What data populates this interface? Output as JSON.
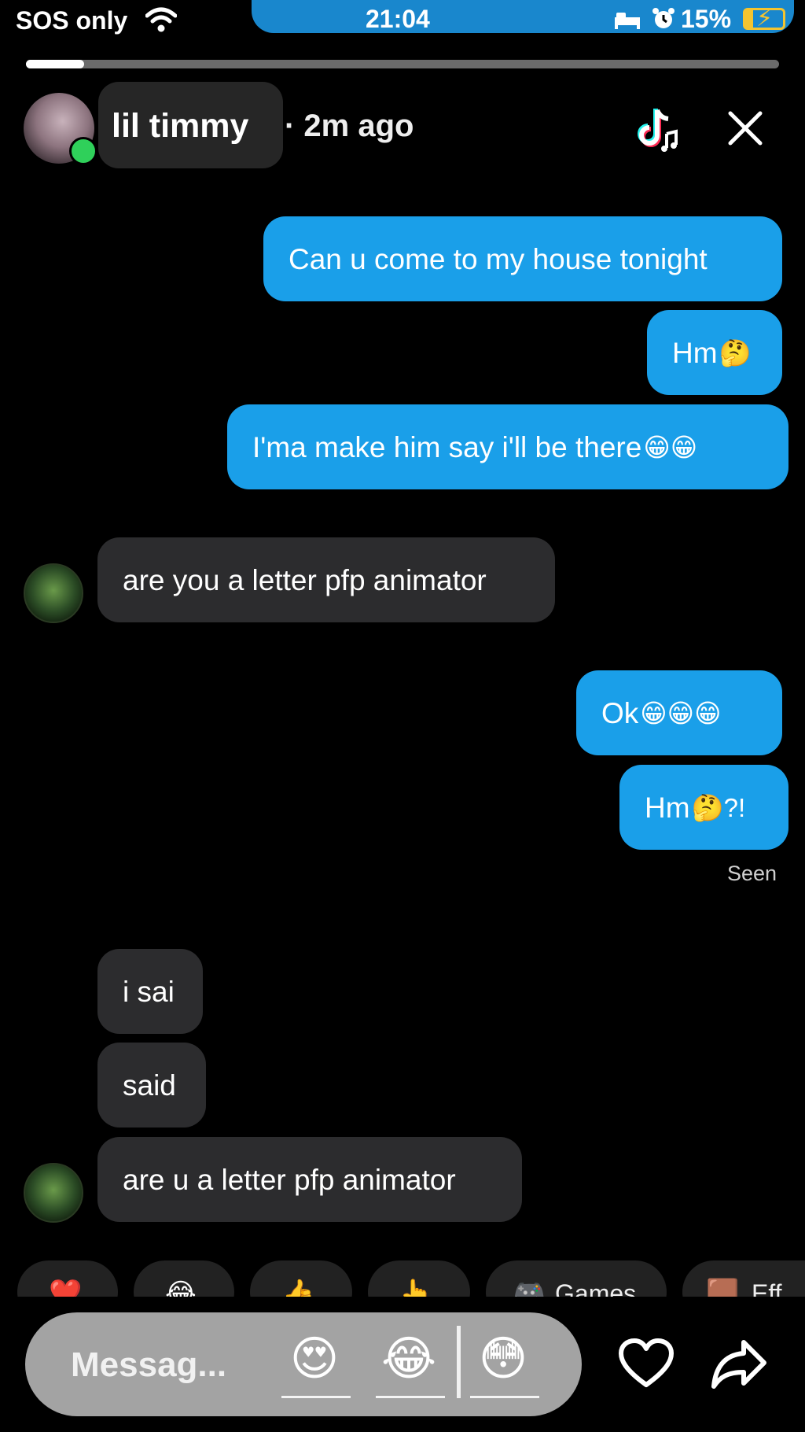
{
  "status_bar": {
    "carrier": "SOS only",
    "time": "21:04",
    "battery_percent": "15%",
    "icons": [
      "wifi-icon",
      "bed-icon",
      "alarm-icon",
      "battery-charging-icon"
    ]
  },
  "story": {
    "progress_fraction": 0.077
  },
  "header": {
    "username": "lil timmy",
    "time_ago": "· 2m ago",
    "online": true,
    "icons": [
      "tiktok-icon",
      "close-icon"
    ]
  },
  "messages": [
    {
      "side": "out",
      "text": "Can u come to my house tonight",
      "emoji": ""
    },
    {
      "side": "out",
      "text": "Hm",
      "emoji": "🤔"
    },
    {
      "side": "out",
      "text": "I'ma make him say i'll be there",
      "emoji": "😁😁"
    },
    {
      "side": "in",
      "text": "are you a letter pfp animator",
      "emoji": ""
    },
    {
      "side": "out",
      "text": "Ok",
      "emoji": "😁😁😁"
    },
    {
      "side": "out",
      "text": "Hm",
      "emoji": "🤔?!"
    },
    {
      "side": "in",
      "text": "i sai",
      "emoji": ""
    },
    {
      "side": "in",
      "text": "said",
      "emoji": ""
    },
    {
      "side": "in",
      "text": "are u a letter pfp animator",
      "emoji": ""
    }
  ],
  "seen_label": "Seen",
  "quick_reactions": [
    {
      "emoji": "❤️",
      "label": ""
    },
    {
      "emoji": "😂",
      "label": ""
    },
    {
      "emoji": "👍",
      "label": ""
    },
    {
      "emoji": "👆",
      "label": ""
    },
    {
      "emoji": "🎮",
      "label": "Games"
    },
    {
      "emoji": "🟫",
      "label": "Eff"
    }
  ],
  "composer": {
    "placeholder": "Messag...",
    "emojis": [
      "😍",
      "😂",
      "😳"
    ],
    "icons": [
      "heart-icon",
      "share-icon"
    ]
  }
}
